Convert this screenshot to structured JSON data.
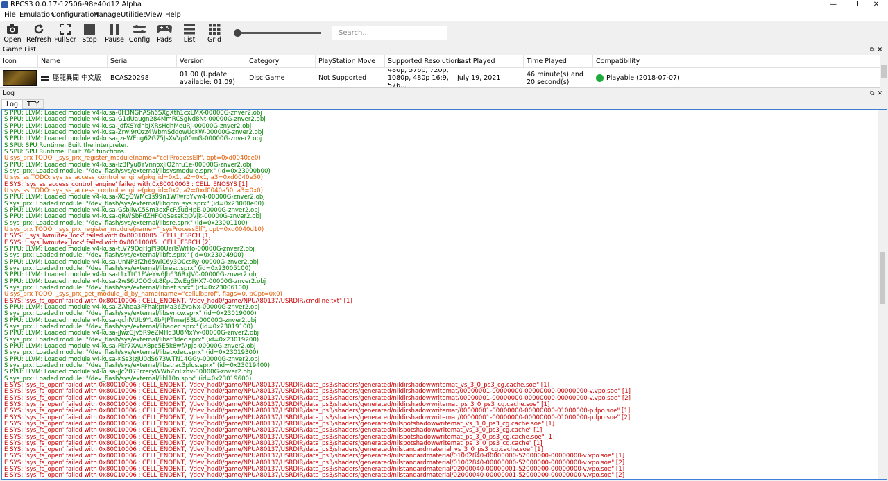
{
  "window": {
    "title": "RPCS3 0.0.17-12506-98e40d12 Alpha",
    "controls": [
      "—",
      "❐",
      "✕"
    ]
  },
  "menu": [
    "File",
    "Emulation",
    "Configuration",
    "Manage",
    "Utilities",
    "View",
    "Help"
  ],
  "toolbar": {
    "buttons": [
      {
        "label": "Open",
        "icon": "open-icon"
      },
      {
        "label": "Refresh",
        "icon": "refresh-icon"
      },
      {
        "label": "FullScr",
        "icon": "fullscreen-icon"
      },
      {
        "label": "Stop",
        "icon": "stop-icon"
      },
      {
        "label": "Pause",
        "icon": "pause-icon"
      },
      {
        "label": "Config",
        "icon": "config-icon"
      },
      {
        "label": "Pads",
        "icon": "gamepad-icon"
      },
      {
        "label": "List",
        "icon": "list-icon"
      },
      {
        "label": "Grid",
        "icon": "grid-icon"
      }
    ],
    "search_placeholder": "Search..."
  },
  "game_list": {
    "title": "Game List",
    "columns": [
      "Icon",
      "Name",
      "Serial",
      "Version",
      "Category",
      "PlayStation Move",
      "Supported Resolutions",
      "Last Played",
      "Time Played",
      "Compatibility"
    ],
    "row": {
      "name": "蜃龍異聞 中文版",
      "serial": "BCAS20298",
      "version": "01.00 (Update available: 01.09)",
      "category": "Disc Game",
      "move": "Not Supported",
      "resolutions": "480p, 576p, 720p, 1080p, 480p 16:9, 576...",
      "last_played": "July 19, 2021",
      "time_played": "46 minute(s) and 20 second(s)",
      "compatibility": "Playable (2018-07-07)",
      "status_color": "#1faa3c"
    }
  },
  "log": {
    "title": "Log",
    "tabs": [
      "Log",
      "TTY"
    ],
    "colors": {
      "S": "#008000",
      "U": "#e05a00",
      "E": "#cc0000"
    },
    "lines": [
      {
        "t": "S",
        "x": "S PPU: LLVM: Loaded module v4-kusa-0H3NGhASh6SXgXth1cxLMX-00000G-znver2.obj"
      },
      {
        "t": "S",
        "x": "S PPU: LLVM: Loaded module v4-kusa-G1dUaugn284MmRCSgNd8Nt-00000G-znver2.obj"
      },
      {
        "t": "S",
        "x": "S PPU: LLVM: Loaded module v4-kusa-JdfXSYdnbJXRsHdhMeuRj-00000G-znver2.obj"
      },
      {
        "t": "S",
        "x": "S PPU: LLVM: Loaded module v4-kusa-Zrwl9rOzz4WbmSdqowUcKW-00000G-znver2.obj"
      },
      {
        "t": "S",
        "x": "S PPU: LLVM: Loaded module v4-kusa-JzeWEng62G75JsXVVp00mG-00000G-znver2.obj"
      },
      {
        "t": "S",
        "x": "S SPU: SPU Runtime: Built the interpreter."
      },
      {
        "t": "S",
        "x": "S SPU: SPU Runtime: Built 766 functions."
      },
      {
        "t": "U",
        "x": "U sys_prx TODO: _sys_prx_register_module(name=\"cellProcessElf\", opt=0xd0040ce0)"
      },
      {
        "t": "S",
        "x": "S PPU: LLVM: Loaded module v4-kusa-Iz3Pyu8YVnnoxJiQ2hfu1e-00000G-znver2.obj"
      },
      {
        "t": "S",
        "x": "S sys_prx: Loaded module: \"/dev_flash/sys/external/libsysmodule.sprx\" (id=0x23000b00)"
      },
      {
        "t": "U",
        "x": "U sys_ss TODO: sys_ss_access_control_engine(pkg_id=0x1, a2=0x1, a3=0xd0040e50)"
      },
      {
        "t": "E",
        "x": "E SYS: 'sys_ss_access_control_engine' failed with 0x80010003 : CELL_ENOSYS [1]"
      },
      {
        "t": "U",
        "x": "U sys_ss TODO: sys_ss_access_control_engine(pkg_id=0x2, a2=0xd0040a50, a3=0x0)"
      },
      {
        "t": "S",
        "x": "S PPU: LLVM: Loaded module v4-kusa-XCgOWMc1s99n1WTwrpYvw4-00000G-znver2.obj"
      },
      {
        "t": "S",
        "x": "S sys_prx: Loaded module: \"/dev_flash/sys/external/libgcm_sys.sprx\" (id=0x23000e00)"
      },
      {
        "t": "S",
        "x": "S PPU: LLVM: Loaded module v4-kusa-GsbjiwC5Sm3exFcR5udHpE-00000G-znver2.obj"
      },
      {
        "t": "S",
        "x": "S PPU: LLVM: Loaded module v4-kusa-gRWSbPdZHFOqSessKqOVjk-00000G-znver2.obj"
      },
      {
        "t": "S",
        "x": "S sys_prx: Loaded module: \"/dev_flash/sys/external/libsre.sprx\" (id=0x23001100)"
      },
      {
        "t": "U",
        "x": "U sys_prx TODO: _sys_prx_register_module(name=\"_sysProcessElf\", opt=0xd0040d10)"
      },
      {
        "t": "E",
        "x": "E SYS: '_sys_lwmutex_lock' failed with 0x80010005 : CELL_ESRCH [1]"
      },
      {
        "t": "E",
        "x": "E SYS: '_sys_lwmutex_lock' failed with 0x80010005 : CELL_ESRCH [2]"
      },
      {
        "t": "S",
        "x": "S PPU: LLVM: Loaded module v4-kusa-tLV79QqHgPl90UziTsWrHo-00000G-znver2.obj"
      },
      {
        "t": "S",
        "x": "S sys_prx: Loaded module: \"/dev_flash/sys/external/libfs.sprx\" (id=0x23004900)"
      },
      {
        "t": "S",
        "x": "S PPU: LLVM: Loaded module v4-kusa-UnNP3fZh65wiC6y3Q0csRy-00000G-znver2.obj"
      },
      {
        "t": "S",
        "x": "S sys_prx: Loaded module: \"/dev_flash/sys/external/libresc.sprx\" (id=0x23005100)"
      },
      {
        "t": "S",
        "x": "S PPU: LLVM: Loaded module v4-kusa-t1xTtC1PVeYw6Jh636RxJV0-00000G-znver2.obj"
      },
      {
        "t": "S",
        "x": "S PPU: LLVM: Loaded module v4-kusa-2wS6UCOGvL8KpqZwEg6HX7-00000G-znver2.obj"
      },
      {
        "t": "S",
        "x": "S sys_prx: Loaded module: \"/dev_flash/sys/external/libnet.sprx\" (id=0x23006100)"
      },
      {
        "t": "U",
        "x": "U sys_prx TODO: _sys_prx_get_module_id_by_name(name=\"cellLibprof\", flags=0, pOpt=0x0)"
      },
      {
        "t": "E",
        "x": "E SYS: 'sys_fs_open' failed with 0x80010006 : CELL_ENOENT, \"/dev_hdd0/game/NPUA80137/USRDIR/cmdline.txt\" [1]"
      },
      {
        "t": "S",
        "x": "S PPU: LLVM: Loaded module v4-kusa-ZAhea3FFhakptMa36ZvaNx-00000G-znver2.obj"
      },
      {
        "t": "S",
        "x": "S sys_prx: Loaded module: \"/dev_flash/sys/external/libsyncw.sprx\" (id=0x23019000)"
      },
      {
        "t": "S",
        "x": "S PPU: LLVM: Loaded module v4-kusa-gchlVUb9Yb4bPJPTmwJ83L-00000G-znver2.obj"
      },
      {
        "t": "S",
        "x": "S sys_prx: Loaded module: \"/dev_flash/sys/external/libadec.sprx\" (id=0x23019100)"
      },
      {
        "t": "S",
        "x": "S PPU: LLVM: Loaded module v4-kusa-jJwzGJv5R9eZMHq3U8MxYv-00000G-znver2.obj"
      },
      {
        "t": "S",
        "x": "S sys_prx: Loaded module: \"/dev_flash/sys/external/libat3dec.sprx\" (id=0x23019200)"
      },
      {
        "t": "S",
        "x": "S PPU: LLVM: Loaded module v4-kusa-Pkr7XAuX8pc5E5k8wfApJc-00000G-znver2.obj"
      },
      {
        "t": "S",
        "x": "S sys_prx: Loaded module: \"/dev_flash/sys/external/libatxdec.sprx\" (id=0x23019300)"
      },
      {
        "t": "S",
        "x": "S PPU: LLVM: Loaded module v4-kusa-KSs3JzJU0dS673WTN14GGy-00000G-znver2.obj"
      },
      {
        "t": "S",
        "x": "S sys_prx: Loaded module: \"/dev_flash/sys/external/libatrac3plus.sprx\" (id=0x23019400)"
      },
      {
        "t": "S",
        "x": "S PPU: LLVM: Loaded module v4-kusa-jJcZ07PrzeryWWhZciLzhv-00000G-znver2.obj"
      },
      {
        "t": "S",
        "x": "S sys_prx: Loaded module: \"/dev_flash/sys/external/libl10n.sprx\" (id=0x23019600)"
      },
      {
        "t": "E",
        "x": "E SYS: 'sys_fs_open' failed with 0x80010006 : CELL_ENOENT, \"/dev_hdd0/game/NPUA80137/USRDIR/data_ps3/shaders/generated/nildirshadowwritemat_vs_3_0_ps3_cg.cache.soe\" [1]"
      },
      {
        "t": "E",
        "x": "E SYS: 'sys_fs_open' failed with 0x80010006 : CELL_ENOENT, \"/dev_hdd0/game/NPUA80137/USRDIR/data_ps3/shaders/generated/nildirshadowwritemat/00000001-00000000-00000000-00000000-v.vpo.soe\" [1]"
      },
      {
        "t": "E",
        "x": "E SYS: 'sys_fs_open' failed with 0x80010006 : CELL_ENOENT, \"/dev_hdd0/game/NPUA80137/USRDIR/data_ps3/shaders/generated/nildirshadowwritemat/00000001-00000000-00000000-00000000-v.vpo.soe\" [2]"
      },
      {
        "t": "E",
        "x": "E SYS: 'sys_fs_open' failed with 0x80010006 : CELL_ENOENT, \"/dev_hdd0/game/NPUA80137/USRDIR/data_ps3/shaders/generated/nildirshadowwritemat_ps_3_0_ps3_cg.cache.soe\" [1]"
      },
      {
        "t": "E",
        "x": "E SYS: 'sys_fs_open' failed with 0x80010006 : CELL_ENOENT, \"/dev_hdd0/game/NPUA80137/USRDIR/data_ps3/shaders/generated/nildirshadowwritemat/00000001-00000000-00000000-01000000-p.fpo.soe\" [1]"
      },
      {
        "t": "E",
        "x": "E SYS: 'sys_fs_open' failed with 0x80010006 : CELL_ENOENT, \"/dev_hdd0/game/NPUA80137/USRDIR/data_ps3/shaders/generated/nildirshadowwritemat/00000001-00000000-00000000-01000000-p.fpo.soe\" [2]"
      },
      {
        "t": "E",
        "x": "E SYS: 'sys_fs_open' failed with 0x80010006 : CELL_ENOENT, \"/dev_hdd0/game/NPUA80137/USRDIR/data_ps3/shaders/generated/nilspotshadowwritemat_vs_3_0_ps3_cg.cache.soe\" [1]"
      },
      {
        "t": "E",
        "x": "E SYS: 'sys_fs_open' failed with 0x80010006 : CELL_ENOENT, \"/dev_hdd0/game/NPUA80137/USRDIR/data_ps3/shaders/generated/nilspotshadowwritemat_vs_3_0_ps3_cg.cache\" [1]"
      },
      {
        "t": "E",
        "x": "E SYS: 'sys_fs_open' failed with 0x80010006 : CELL_ENOENT, \"/dev_hdd0/game/NPUA80137/USRDIR/data_ps3/shaders/generated/nilspotshadowwritemat_ps_3_0_ps3_cg.cache.soe\" [1]"
      },
      {
        "t": "E",
        "x": "E SYS: 'sys_fs_open' failed with 0x80010006 : CELL_ENOENT, \"/dev_hdd0/game/NPUA80137/USRDIR/data_ps3/shaders/generated/nilspotshadowwritemat_ps_3_0_ps3_cg.cache\" [1]"
      },
      {
        "t": "E",
        "x": "E SYS: 'sys_fs_open' failed with 0x80010006 : CELL_ENOENT, \"/dev_hdd0/game/NPUA80137/USRDIR/data_ps3/shaders/generated/nilstandardmaterial_vs_3_0_ps3_cg.cache.soe\" [1]"
      },
      {
        "t": "E",
        "x": "E SYS: 'sys_fs_open' failed with 0x80010006 : CELL_ENOENT, \"/dev_hdd0/game/NPUA80137/USRDIR/data_ps3/shaders/generated/nilstandardmaterial/01002840-00000000-52000000-00000000-v.vpo.soe\" [1]"
      },
      {
        "t": "E",
        "x": "E SYS: 'sys_fs_open' failed with 0x80010006 : CELL_ENOENT, \"/dev_hdd0/game/NPUA80137/USRDIR/data_ps3/shaders/generated/nilstandardmaterial/01002840-00000000-52000000-00000000-v.vpo.soe\" [2]"
      },
      {
        "t": "E",
        "x": "E SYS: 'sys_fs_open' failed with 0x80010006 : CELL_ENOENT, \"/dev_hdd0/game/NPUA80137/USRDIR/data_ps3/shaders/generated/nilstandardmaterial/02000040-00000001-52000000-00000000-v.vpo.soe\" [1]"
      },
      {
        "t": "E",
        "x": "E SYS: 'sys_fs_open' failed with 0x80010006 : CELL_ENOENT, \"/dev_hdd0/game/NPUA80137/USRDIR/data_ps3/shaders/generated/nilstandardmaterial/02000040-00000001-52000000-00000000-v.vpo.soe\" [2]"
      }
    ]
  }
}
